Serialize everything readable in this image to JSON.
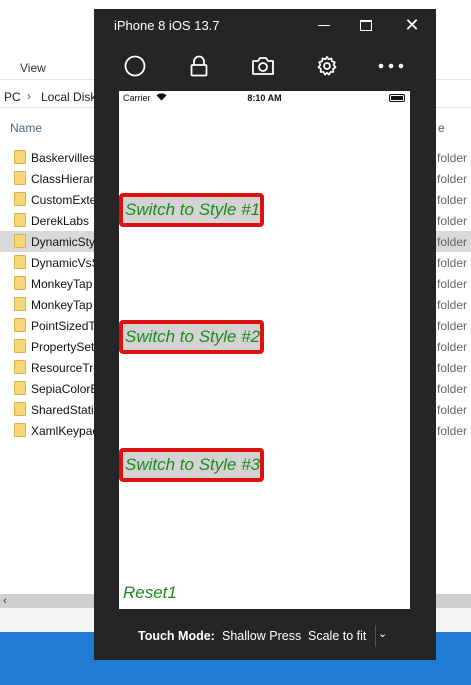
{
  "explorer": {
    "ribbon_view": "View",
    "address": {
      "pc": "PC",
      "separator": "›",
      "drive": "Local Disk"
    },
    "column_name": "Name",
    "column_right": "e",
    "type_label": "folder",
    "rows": [
      "Baskervilles",
      "ClassHierarc",
      "CustomExte",
      "DerekLabs",
      "DynamicSty",
      "DynamicVsS",
      "MonkeyTap",
      "MonkeyTap",
      "PointSizedTe",
      "PropertySet",
      "ResourceTre",
      "SepiaColorE",
      "SharedStatio",
      "XamlKeypac"
    ],
    "scroll_left": "‹"
  },
  "simulator": {
    "title": "iPhone 8 iOS 13.7",
    "window_controls": {
      "close": "✕"
    },
    "toolbar_icons": [
      "home-circle-icon",
      "lock-icon",
      "camera-icon",
      "gear-icon",
      "more-dots-icon"
    ],
    "status_bar": {
      "carrier": "Carrier",
      "time": "8:10 AM"
    },
    "buttons": {
      "style1": "Switch to Style #1",
      "style2": "Switch to Style #2",
      "style3": "Switch to Style #3",
      "reset": "Reset1"
    },
    "bottom": {
      "touch_mode_label": "Touch Mode:",
      "touch_mode_value": "Shallow Press",
      "scale": "Scale to fit",
      "chevron": "⌄"
    }
  },
  "colors": {
    "button_text": "#1e8a1e",
    "button_border": "#e01010",
    "button_bg": "#d3d3d3",
    "sim_bg": "#252525",
    "desktop": "#1f7bd4"
  }
}
